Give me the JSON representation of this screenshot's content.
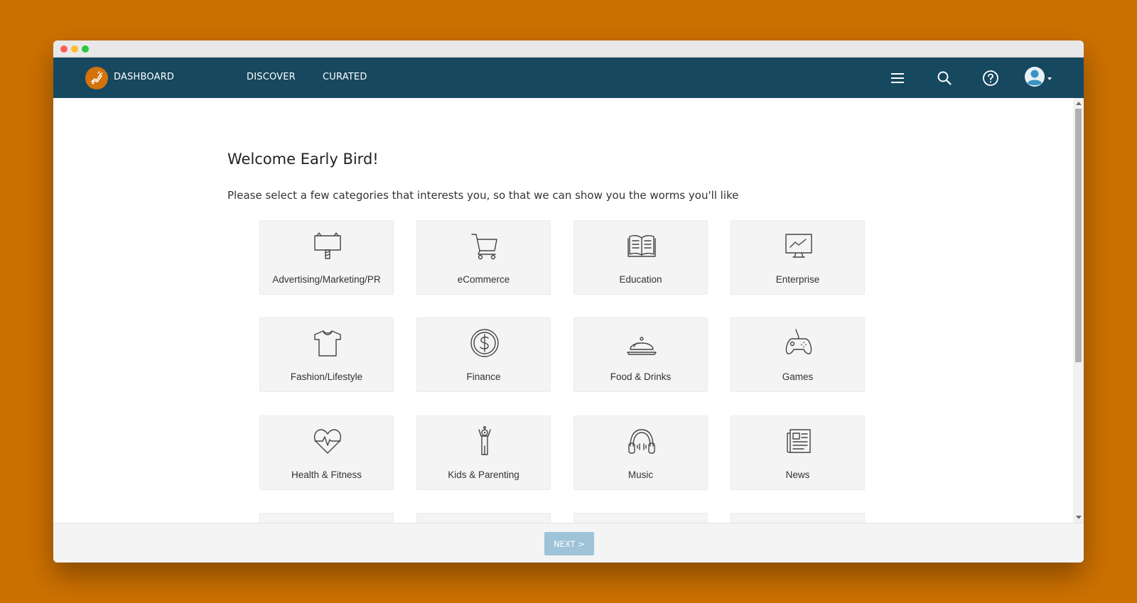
{
  "nav": {
    "brand_label": "DASHBOARD",
    "links": [
      {
        "label": "DISCOVER"
      },
      {
        "label": "CURATED"
      }
    ],
    "icons": [
      "menu-icon",
      "search-icon",
      "help-icon",
      "user-avatar-icon"
    ]
  },
  "page": {
    "title": "Welcome Early Bird!",
    "subtitle": "Please select a few categories that interests you, so that we can show you the worms you'll like"
  },
  "categories": [
    {
      "label": "Advertising/Marketing/PR",
      "icon": "signboard-icon"
    },
    {
      "label": "eCommerce",
      "icon": "shopping-cart-icon"
    },
    {
      "label": "Education",
      "icon": "open-book-icon"
    },
    {
      "label": "Enterprise",
      "icon": "presentation-chart-icon"
    },
    {
      "label": "Fashion/Lifestyle",
      "icon": "tshirt-icon"
    },
    {
      "label": "Finance",
      "icon": "dollar-coin-icon"
    },
    {
      "label": "Food & Drinks",
      "icon": "food-cloche-icon"
    },
    {
      "label": "Games",
      "icon": "gamepad-icon"
    },
    {
      "label": "Health & Fitness",
      "icon": "heartbeat-icon"
    },
    {
      "label": "Kids & Parenting",
      "icon": "child-icon"
    },
    {
      "label": "Music",
      "icon": "headphones-icon"
    },
    {
      "label": "News",
      "icon": "newspaper-icon"
    }
  ],
  "footer": {
    "next_label": "NEXT >"
  },
  "colors": {
    "background": "#cc7000",
    "navbar": "#16485f",
    "brand": "#d4720c",
    "card": "#f4f4f4",
    "next_button": "#9fc3d8",
    "chat_button": "#f45b5b"
  }
}
